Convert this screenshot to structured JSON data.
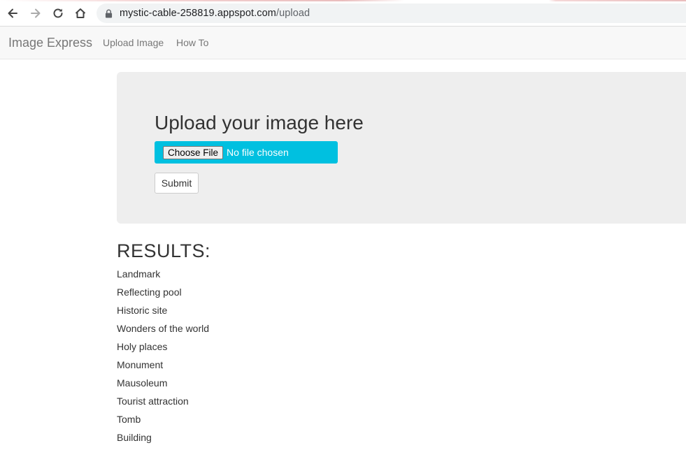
{
  "browser": {
    "url_host": "mystic-cable-258819.appspot.com",
    "url_path": "/upload",
    "icons": [
      "back-arrow-icon",
      "forward-arrow-icon",
      "reload-icon",
      "home-icon",
      "lock-icon"
    ]
  },
  "navbar": {
    "brand": "Image Express",
    "links": [
      "Upload Image",
      "How To"
    ]
  },
  "upload": {
    "heading": "Upload your image here",
    "choose_file_label": "Choose File",
    "no_file_text": "No file chosen",
    "submit_label": "Submit"
  },
  "results": {
    "heading": "RESULTS:",
    "items": [
      "Landmark",
      "Reflecting pool",
      "Historic site",
      "Wonders of the world",
      "Holy places",
      "Monument",
      "Mausoleum",
      "Tourist attraction",
      "Tomb",
      "Building"
    ]
  },
  "colors": {
    "file_bar": "#00c0e0",
    "jumbotron": "#eeeeee",
    "navbar": "#f8f8f8"
  }
}
